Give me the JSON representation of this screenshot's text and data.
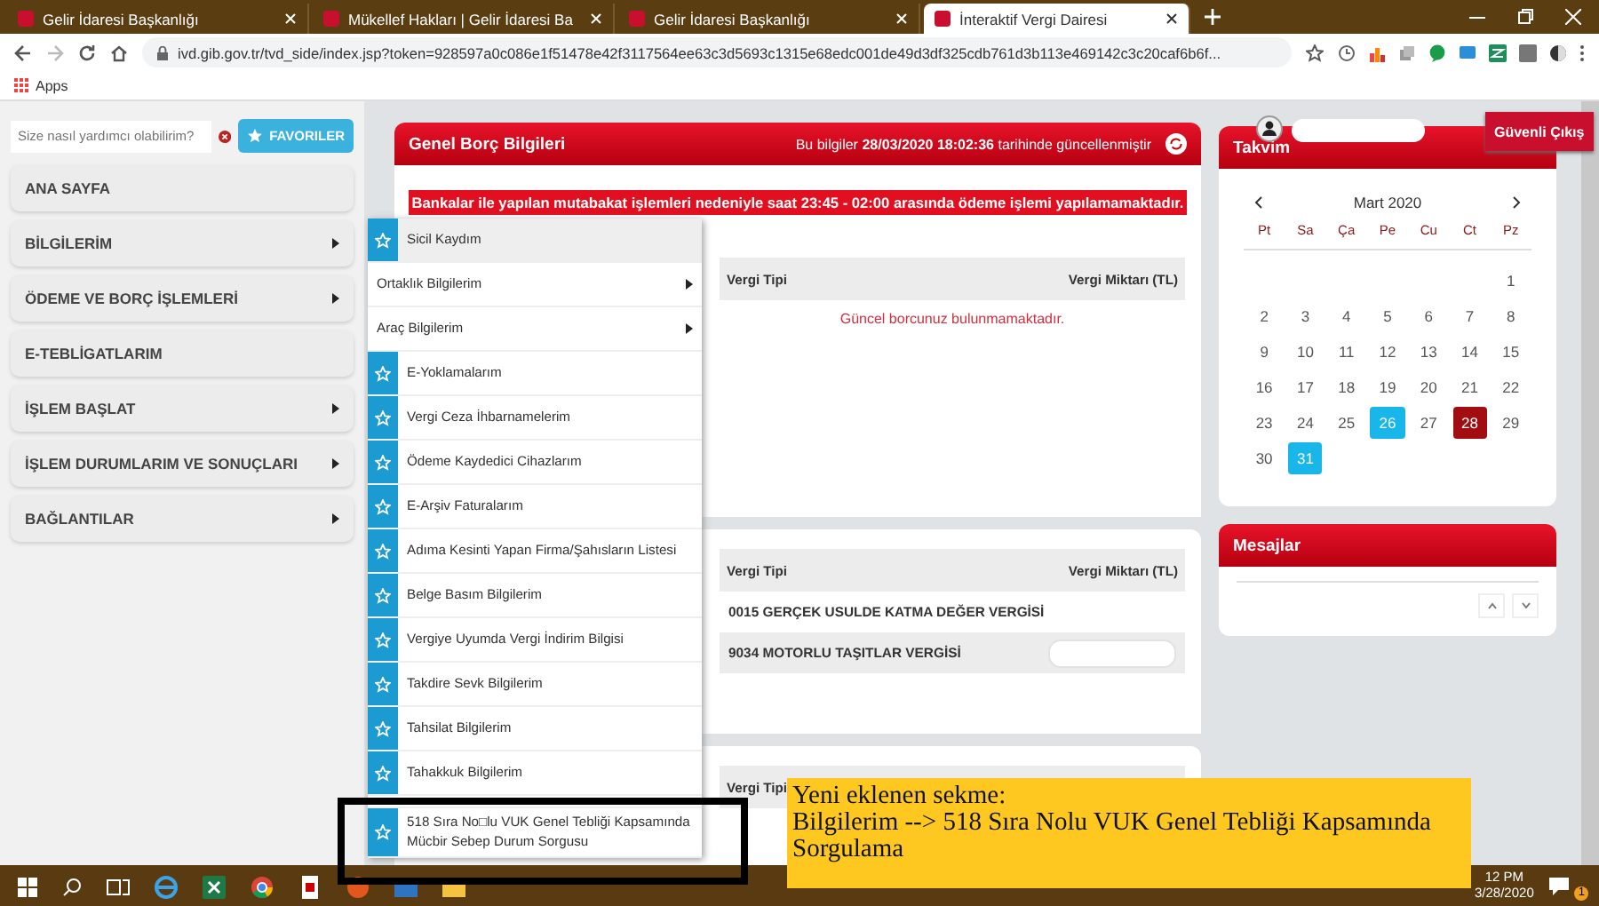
{
  "browser": {
    "tabs": [
      {
        "title": "Gelir İdaresi Başkanlığı",
        "selected": false
      },
      {
        "title": "Mükellef Hakları | Gelir İdaresi Ba",
        "selected": false
      },
      {
        "title": "Gelir İdaresi Başkanlığı",
        "selected": false
      },
      {
        "title": "İnteraktif Vergi Dairesi",
        "selected": true
      }
    ],
    "url": "ivd.gib.gov.tr/tvd_side/index.jsp?token=928597a0c086e1f51478e42f3117564ee63c3d5693c1315e68edc001de49d3df325cdb761d3b113e469142c3c20caf6b6f...",
    "bookmarks": [
      "Apps"
    ]
  },
  "sidebar": {
    "search_placeholder": "Size nasıl yardımcı olabilirim?",
    "favorites_button": "FAVORILER",
    "items": [
      {
        "label": "ANA SAYFA",
        "has_submenu": false
      },
      {
        "label": "BİLGİLERİM",
        "has_submenu": true
      },
      {
        "label": "ÖDEME VE BORÇ İŞLEMLERİ",
        "has_submenu": true
      },
      {
        "label": "E-TEBLİGATLARIM",
        "has_submenu": false
      },
      {
        "label": "İŞLEM BAŞLAT",
        "has_submenu": true
      },
      {
        "label": "İŞLEM DURUMLARIM VE SONUÇLARI",
        "has_submenu": true
      },
      {
        "label": "BAĞLANTILAR",
        "has_submenu": true
      }
    ]
  },
  "debt_panel": {
    "title": "Genel Borç Bilgileri",
    "updated_note": "Bu bilgiler **28/03/2020 18:02:36** tarihinde güncellenmiştir",
    "banner": "Bankalar ile yapılan mutabakat işlemleri nedeniyle saat 23:45 - 02:00 arasında ödeme işlemi yapılamamaktadır.",
    "columns": [
      "Vergi Tipi",
      "Vergi Miktarı (TL)"
    ],
    "empty_message": "Güncel borcunuz bulunmamaktadır."
  },
  "tax_table": {
    "columns": [
      "Vergi Tipi",
      "Vergi Miktarı (TL)"
    ],
    "rows": [
      {
        "type": "0015 GERÇEK USULDE KATMA DEĞER VERGİSİ",
        "amount_hidden": false
      },
      {
        "type": "9034 MOTORLU TAŞITLAR VERGİSİ",
        "amount_hidden": true
      }
    ]
  },
  "third_table": {
    "columns": [
      "Vergi Tipi"
    ]
  },
  "user": {
    "name_hidden": true,
    "logout_button": "Güvenli Çıkış"
  },
  "calendar": {
    "title": "Takvim",
    "month": "Mart 2020",
    "weekdays": [
      "Pt",
      "Sa",
      "Ça",
      "Pe",
      "Cu",
      "Ct",
      "Pz"
    ],
    "weeks": [
      [
        {
          "day": "1",
          "selected": false,
          "marked": false
        }
      ],
      [
        {
          "day": "2",
          "selected": false,
          "marked": false
        },
        {
          "day": "3",
          "selected": false,
          "marked": false
        },
        {
          "day": "4",
          "selected": false,
          "marked": false
        },
        {
          "day": "5",
          "selected": false,
          "marked": false
        },
        {
          "day": "6",
          "selected": false,
          "marked": false
        },
        {
          "day": "7",
          "selected": false,
          "marked": false
        },
        {
          "day": "8",
          "selected": false,
          "marked": false
        }
      ],
      [
        {
          "day": "9",
          "selected": false,
          "marked": false
        },
        {
          "day": "10",
          "selected": false,
          "marked": false
        },
        {
          "day": "11",
          "selected": false,
          "marked": false
        },
        {
          "day": "12",
          "selected": false,
          "marked": false
        },
        {
          "day": "13",
          "selected": false,
          "marked": false
        },
        {
          "day": "14",
          "selected": false,
          "marked": false
        },
        {
          "day": "15",
          "selected": false,
          "marked": false
        }
      ],
      [
        {
          "day": "16",
          "selected": false,
          "marked": false
        },
        {
          "day": "17",
          "selected": false,
          "marked": false
        },
        {
          "day": "18",
          "selected": false,
          "marked": false
        },
        {
          "day": "19",
          "selected": false,
          "marked": false
        },
        {
          "day": "20",
          "selected": false,
          "marked": false
        },
        {
          "day": "21",
          "selected": false,
          "marked": false
        },
        {
          "day": "22",
          "selected": false,
          "marked": false
        }
      ],
      [
        {
          "day": "23",
          "selected": false,
          "marked": false
        },
        {
          "day": "24",
          "selected": false,
          "marked": false
        },
        {
          "day": "25",
          "selected": false,
          "marked": false
        },
        {
          "day": "26",
          "selected": false,
          "marked": true
        },
        {
          "day": "27",
          "selected": false,
          "marked": false
        },
        {
          "day": "28",
          "selected": true,
          "marked": false
        },
        {
          "day": "29",
          "selected": false,
          "marked": false
        }
      ],
      [
        {
          "day": "30",
          "selected": false,
          "marked": false
        },
        {
          "day": "31",
          "selected": false,
          "marked": true
        }
      ]
    ]
  },
  "messages": {
    "title": "Mesajlar"
  },
  "menu": {
    "items": [
      {
        "label": "Sicil Kaydım",
        "kind": "star",
        "selected": true
      },
      {
        "label": "Ortaklık Bilgilerim",
        "kind": "submenu",
        "selected": false
      },
      {
        "label": "Araç Bilgilerim",
        "kind": "submenu",
        "selected": false
      },
      {
        "label": "E-Yoklamalarım",
        "kind": "star",
        "selected": false
      },
      {
        "label": "Vergi Ceza İhbarnamelerim",
        "kind": "star",
        "selected": false
      },
      {
        "label": "Ödeme Kaydedici Cihazlarım",
        "kind": "star",
        "selected": false
      },
      {
        "label": "E-Arşiv Faturalarım",
        "kind": "star",
        "selected": false
      },
      {
        "label": "Adıma Kesinti Yapan Firma/Şahısların Listesi",
        "kind": "star",
        "selected": false
      },
      {
        "label": "Belge Basım Bilgilerim",
        "kind": "star",
        "selected": false
      },
      {
        "label": "Vergiye Uyumda Vergi İndirim Bilgisi",
        "kind": "star",
        "selected": false
      },
      {
        "label": "Takdire Sevk Bilgilerim",
        "kind": "star",
        "selected": false
      },
      {
        "label": "Tahsilat Bilgilerim",
        "kind": "star",
        "selected": false
      },
      {
        "label": "Tahakkuk Bilgilerim",
        "kind": "star",
        "selected": false
      },
      {
        "label": "518 Sıra No□lu VUK Genel Tebliği Kapsamında Mücbir Sebep Durum Sorgusu",
        "kind": "star",
        "selected": false
      }
    ]
  },
  "highlight_frame": {
    "shown": true
  },
  "callout": {
    "lines": [
      "Yeni eklenen sekme:",
      "Bilgilerim --> 518 Sıra Nolu VUK Genel Tebliği Kapsamında Sorgulama"
    ]
  },
  "taskbar": {
    "time": "12 PM",
    "date": "3/28/2020",
    "notification_count": "1"
  }
}
